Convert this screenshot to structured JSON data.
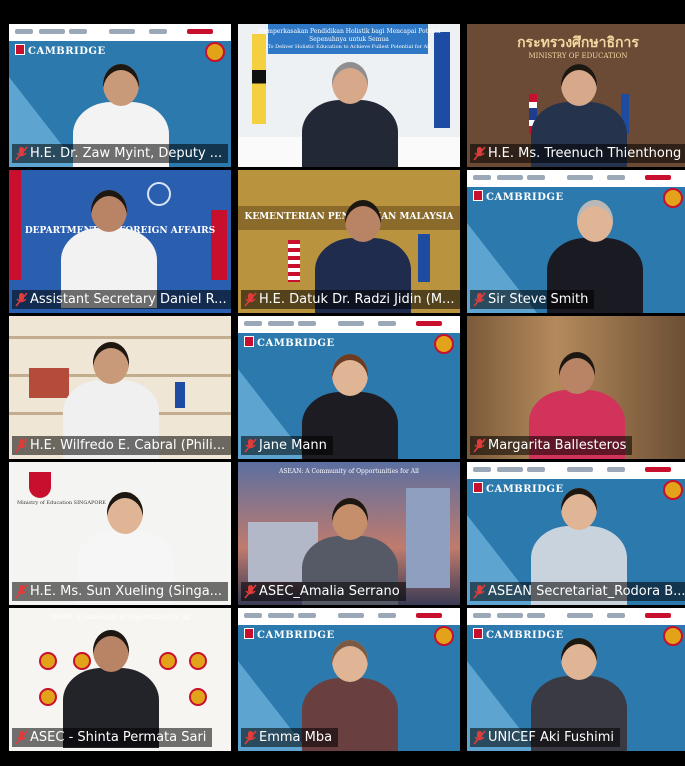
{
  "meeting": {
    "participants": [
      {
        "name": "H.E. Dr. Zaw Myint, Deputy ...",
        "background": "cambridge"
      },
      {
        "name": "",
        "background": "bruneiOffice",
        "banner": "Memperkasakan Pendidikan Holistik bagi Mencapai Potensi Sepenuhnya untuk Semua",
        "banner_sub": "To Deliver Holistic Education to Achieve Fullest Potential for All"
      },
      {
        "name": "H.E. Ms. Treenuch Thienthong",
        "background": "thaiMinistry",
        "wall_text": "กระทรวงศึกษาธิการ",
        "wall_sub": "MINISTRY OF EDUCATION"
      },
      {
        "name": "Assistant Secretary Daniel R...",
        "background": "dfa",
        "wall_text": "DEPARTMENT OF FOREIGN AFFAIRS"
      },
      {
        "name": "H.E. Datuk Dr. Radzi Jidin (M...",
        "background": "malaysia",
        "wall_text": "KEMENTERIAN PENDIDIKAN MALAYSIA"
      },
      {
        "name": "Sir Steve Smith",
        "background": "cambridge"
      },
      {
        "name": "H.E. Wilfredo E. Cabral (Phili...",
        "background": "shelves"
      },
      {
        "name": "Jane Mann",
        "background": "cambridge"
      },
      {
        "name": "Margarita Ballesteros",
        "background": "blurBooks"
      },
      {
        "name": "H.E. Ms. Sun Xueling (Singa...",
        "background": "moeSingapore",
        "logo_caption": "Ministry of Education SINGAPORE"
      },
      {
        "name": "ASEC_Amalia Serrano",
        "background": "aseanCity",
        "banner": "ASEAN: A Community of Opportunities for All"
      },
      {
        "name": "ASEAN Secretariat_Rodora B...",
        "background": "cambridge"
      },
      {
        "name": "ASEC - Shinta Permata Sari",
        "background": "aseanLogos",
        "banner": "ASEAN: A Community of Opportunities for All"
      },
      {
        "name": "Emma Mba",
        "background": "cambridge"
      },
      {
        "name": "UNICEF Aki Fushimi",
        "background": "cambridge"
      }
    ],
    "brand": {
      "cambridge_label": "CAMBRIDGE"
    },
    "colors": {
      "cambridge_blue": "#2b79ad",
      "asean_gold": "#e2a21a",
      "mute_red": "#e03c3c"
    }
  }
}
